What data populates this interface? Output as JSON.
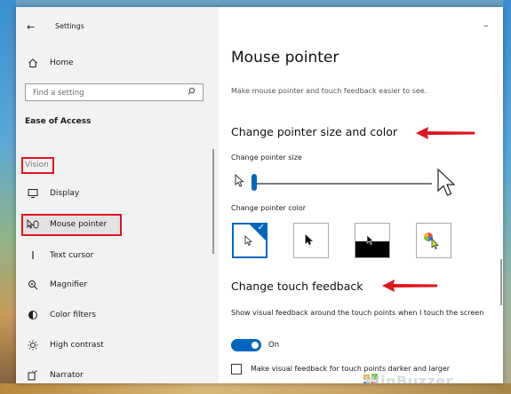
{
  "window": {
    "title": "Settings",
    "controls": {
      "minimize": "–",
      "maximize": "☐",
      "close": "✕"
    }
  },
  "sidebar": {
    "home": "Home",
    "search_placeholder": "Find a setting",
    "section": "Ease of Access",
    "group": "Vision",
    "items": [
      {
        "label": "Display",
        "icon": "monitor-icon"
      },
      {
        "label": "Mouse pointer",
        "icon": "mouse-pointer-icon",
        "selected": true
      },
      {
        "label": "Text cursor",
        "icon": "text-cursor-icon"
      },
      {
        "label": "Magnifier",
        "icon": "magnifier-icon"
      },
      {
        "label": "Color filters",
        "icon": "color-filters-icon"
      },
      {
        "label": "High contrast",
        "icon": "high-contrast-icon"
      },
      {
        "label": "Narrator",
        "icon": "narrator-icon"
      }
    ]
  },
  "main": {
    "title": "Mouse pointer",
    "description": "Make mouse pointer and touch feedback easier to see.",
    "size_color_heading": "Change pointer size and color",
    "size_label": "Change pointer size",
    "size_value": 1,
    "color_label": "Change pointer color",
    "color_options": [
      "white",
      "black",
      "inverted",
      "custom"
    ],
    "selected_color": "white",
    "touch_heading": "Change touch feedback",
    "touch_desc": "Show visual feedback around the touch points when I touch the screen",
    "touch_toggle_state": "On",
    "darker_label": "Make visual feedback for touch points darker and larger"
  },
  "watermark": "WinBuzzer",
  "colors": {
    "accent": "#0067c0",
    "annotation": "#e0151e"
  }
}
